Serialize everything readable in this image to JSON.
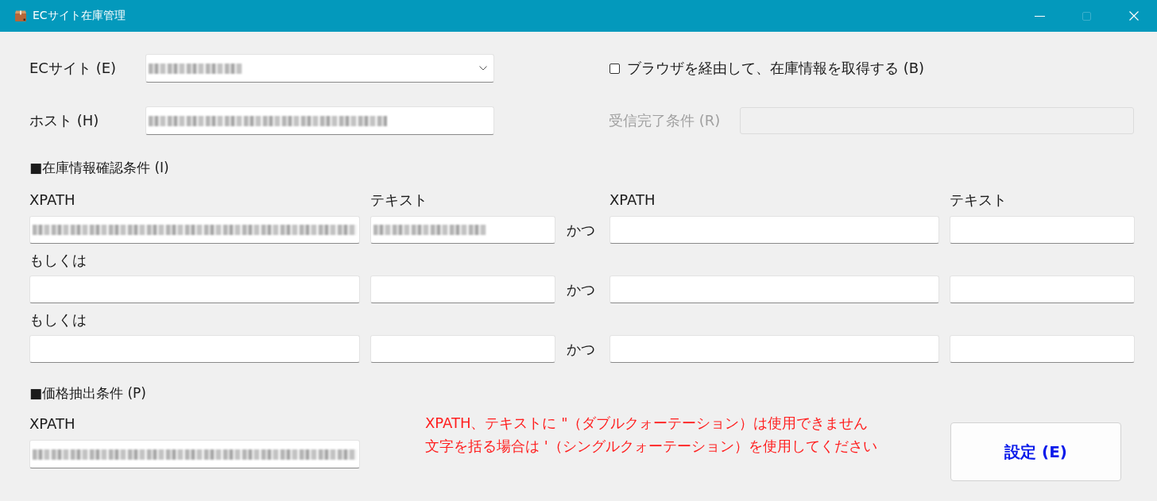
{
  "window": {
    "title": "ECサイト在庫管理",
    "controls": [
      {
        "kind": "minimize",
        "disabled": false
      },
      {
        "kind": "maximize",
        "disabled": true
      },
      {
        "kind": "close",
        "disabled": false
      }
    ]
  },
  "site": {
    "label": "ECサイト (E)",
    "redacted": true
  },
  "browser_option": {
    "label": "ブラウザを経由して、在庫情報を取得する (B)",
    "checked": false
  },
  "host": {
    "label": "ホスト (H)",
    "redacted": true
  },
  "receive_condition": {
    "label": "受信完了条件 (R)",
    "disabled": true
  },
  "stock_section": {
    "title": "■在庫情報確認条件 (I)",
    "columns": [
      "XPATH",
      "テキスト",
      "XPATH",
      "テキスト"
    ],
    "rows": [
      {
        "cells": [
          {
            "redacted": true
          },
          {
            "redacted": true
          },
          {
            "redacted": false
          },
          {
            "redacted": false
          }
        ],
        "joiner": "かつ"
      },
      {
        "label": "もしくは",
        "cells": [
          {
            "redacted": false
          },
          {
            "redacted": false
          },
          {
            "redacted": false
          },
          {
            "redacted": false
          }
        ],
        "joiner": "かつ"
      },
      {
        "label": "もしくは",
        "cells": [
          {
            "redacted": false
          },
          {
            "redacted": false
          },
          {
            "redacted": false
          },
          {
            "redacted": false
          }
        ],
        "joiner": "かつ"
      }
    ]
  },
  "price_section": {
    "title": "■価格抽出条件 (P)",
    "xpath_label": "XPATH",
    "xpath": {
      "redacted": true
    }
  },
  "notice": [
    "XPATH、テキストに \"（ダブルクォーテーション）は使用できません",
    "文字を括る場合は '（シングルクォーテーション）を使用してください"
  ],
  "submit_button": "設定 (E)"
}
